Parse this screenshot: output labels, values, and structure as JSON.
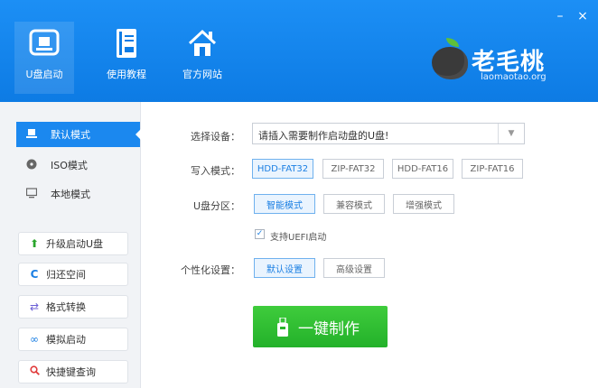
{
  "header": {
    "nav": [
      {
        "label": "U盘启动",
        "icon": "usb-drive-icon"
      },
      {
        "label": "使用教程",
        "icon": "book-icon"
      },
      {
        "label": "官方网站",
        "icon": "home-icon"
      }
    ],
    "window": {
      "minimize": "–",
      "close": "×"
    },
    "logo": {
      "brand": "老毛桃",
      "site": "laomaotao.org"
    }
  },
  "sidebar": {
    "modes": [
      {
        "label": "默认模式",
        "icon": "usb-drive-icon"
      },
      {
        "label": "ISO模式",
        "icon": "disc-icon"
      },
      {
        "label": "本地模式",
        "icon": "monitor-icon"
      }
    ],
    "tools": [
      {
        "label": "升级启动U盘",
        "icon": "arrow-up-icon"
      },
      {
        "label": "归还空间",
        "icon": "refresh-icon"
      },
      {
        "label": "格式转换",
        "icon": "swap-icon"
      },
      {
        "label": "模拟启动",
        "icon": "link-icon"
      },
      {
        "label": "快捷键查询",
        "icon": "search-icon"
      }
    ]
  },
  "main": {
    "device_label": "选择设备：",
    "device_value": "请插入需要制作启动盘的U盘!",
    "write_label": "写入模式：",
    "write_options": [
      "HDD-FAT32",
      "ZIP-FAT32",
      "HDD-FAT16",
      "ZIP-FAT16"
    ],
    "partition_label": "U盘分区：",
    "partition_options": [
      "智能模式",
      "兼容模式",
      "增强模式"
    ],
    "uefi_label": "支持UEFI启动",
    "personal_label": "个性化设置：",
    "personal_options": [
      "默认设置",
      "高级设置"
    ],
    "make_label": "一键制作"
  },
  "colors": {
    "header": "#0d7be4",
    "accent": "#1b88ef",
    "green": "#2ab52c"
  }
}
